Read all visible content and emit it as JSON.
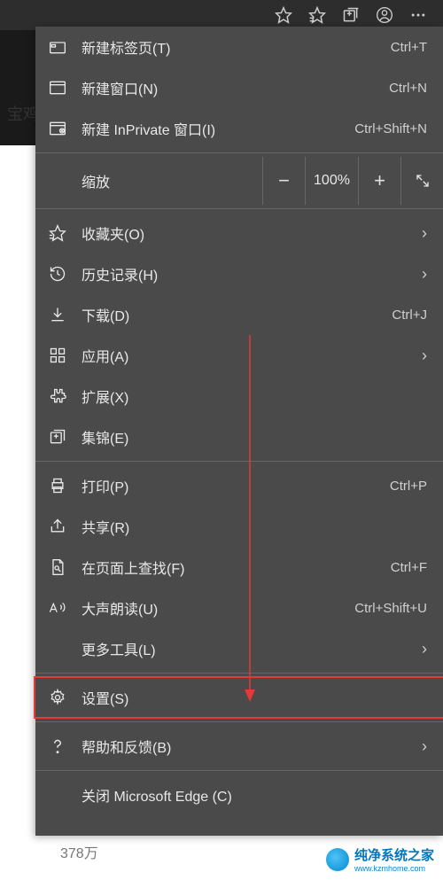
{
  "page": {
    "partial_text": "宝鸡",
    "bottom_number": "378万"
  },
  "toolbar": {
    "icons": [
      "star-outline",
      "favorites",
      "collections",
      "profile",
      "more"
    ]
  },
  "zoom": {
    "label": "缩放",
    "minus": "−",
    "value": "100%",
    "plus": "+",
    "fullscreen": "⤢"
  },
  "menu": {
    "new_tab": {
      "label": "新建标签页(T)",
      "shortcut": "Ctrl+T"
    },
    "new_window": {
      "label": "新建窗口(N)",
      "shortcut": "Ctrl+N"
    },
    "new_inprivate": {
      "label": "新建 InPrivate 窗口(I)",
      "shortcut": "Ctrl+Shift+N"
    },
    "favorites": {
      "label": "收藏夹(O)"
    },
    "history": {
      "label": "历史记录(H)"
    },
    "downloads": {
      "label": "下载(D)",
      "shortcut": "Ctrl+J"
    },
    "apps": {
      "label": "应用(A)"
    },
    "extensions": {
      "label": "扩展(X)"
    },
    "collections": {
      "label": "集锦(E)"
    },
    "print": {
      "label": "打印(P)",
      "shortcut": "Ctrl+P"
    },
    "share": {
      "label": "共享(R)"
    },
    "find": {
      "label": "在页面上查找(F)",
      "shortcut": "Ctrl+F"
    },
    "read_aloud": {
      "label": "大声朗读(U)",
      "shortcut": "Ctrl+Shift+U"
    },
    "more_tools": {
      "label": "更多工具(L)"
    },
    "settings": {
      "label": "设置(S)"
    },
    "help": {
      "label": "帮助和反馈(B)"
    },
    "close": {
      "label": "关闭 Microsoft Edge (C)"
    }
  },
  "watermark": {
    "title": "纯净系统之家",
    "url": "www.kzmhome.com"
  }
}
